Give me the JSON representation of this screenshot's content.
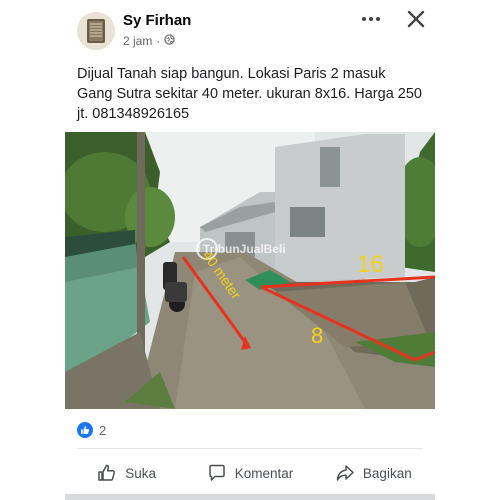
{
  "post": {
    "author": "Sy Firhan",
    "time": "2 jam",
    "text": "Dijual Tanah siap bangun. Lokasi Paris 2 masuk Gang Sutra sekitar 40 meter. ukuran 8x16. Harga 250 jt. 081348926165"
  },
  "photo": {
    "watermark": "TribunJualBeli",
    "label_distance": "40 meter",
    "label_length": "16",
    "label_width": "8"
  },
  "reactions": {
    "count": "2",
    "icon": "like-icon"
  },
  "actions": {
    "like_label": "Suka",
    "comment_label": "Komentar",
    "share_label": "Bagikan"
  },
  "colors": {
    "accent": "#1877f2",
    "annotation_red": "#e8321e",
    "annotation_yellow": "#f3d21a"
  }
}
